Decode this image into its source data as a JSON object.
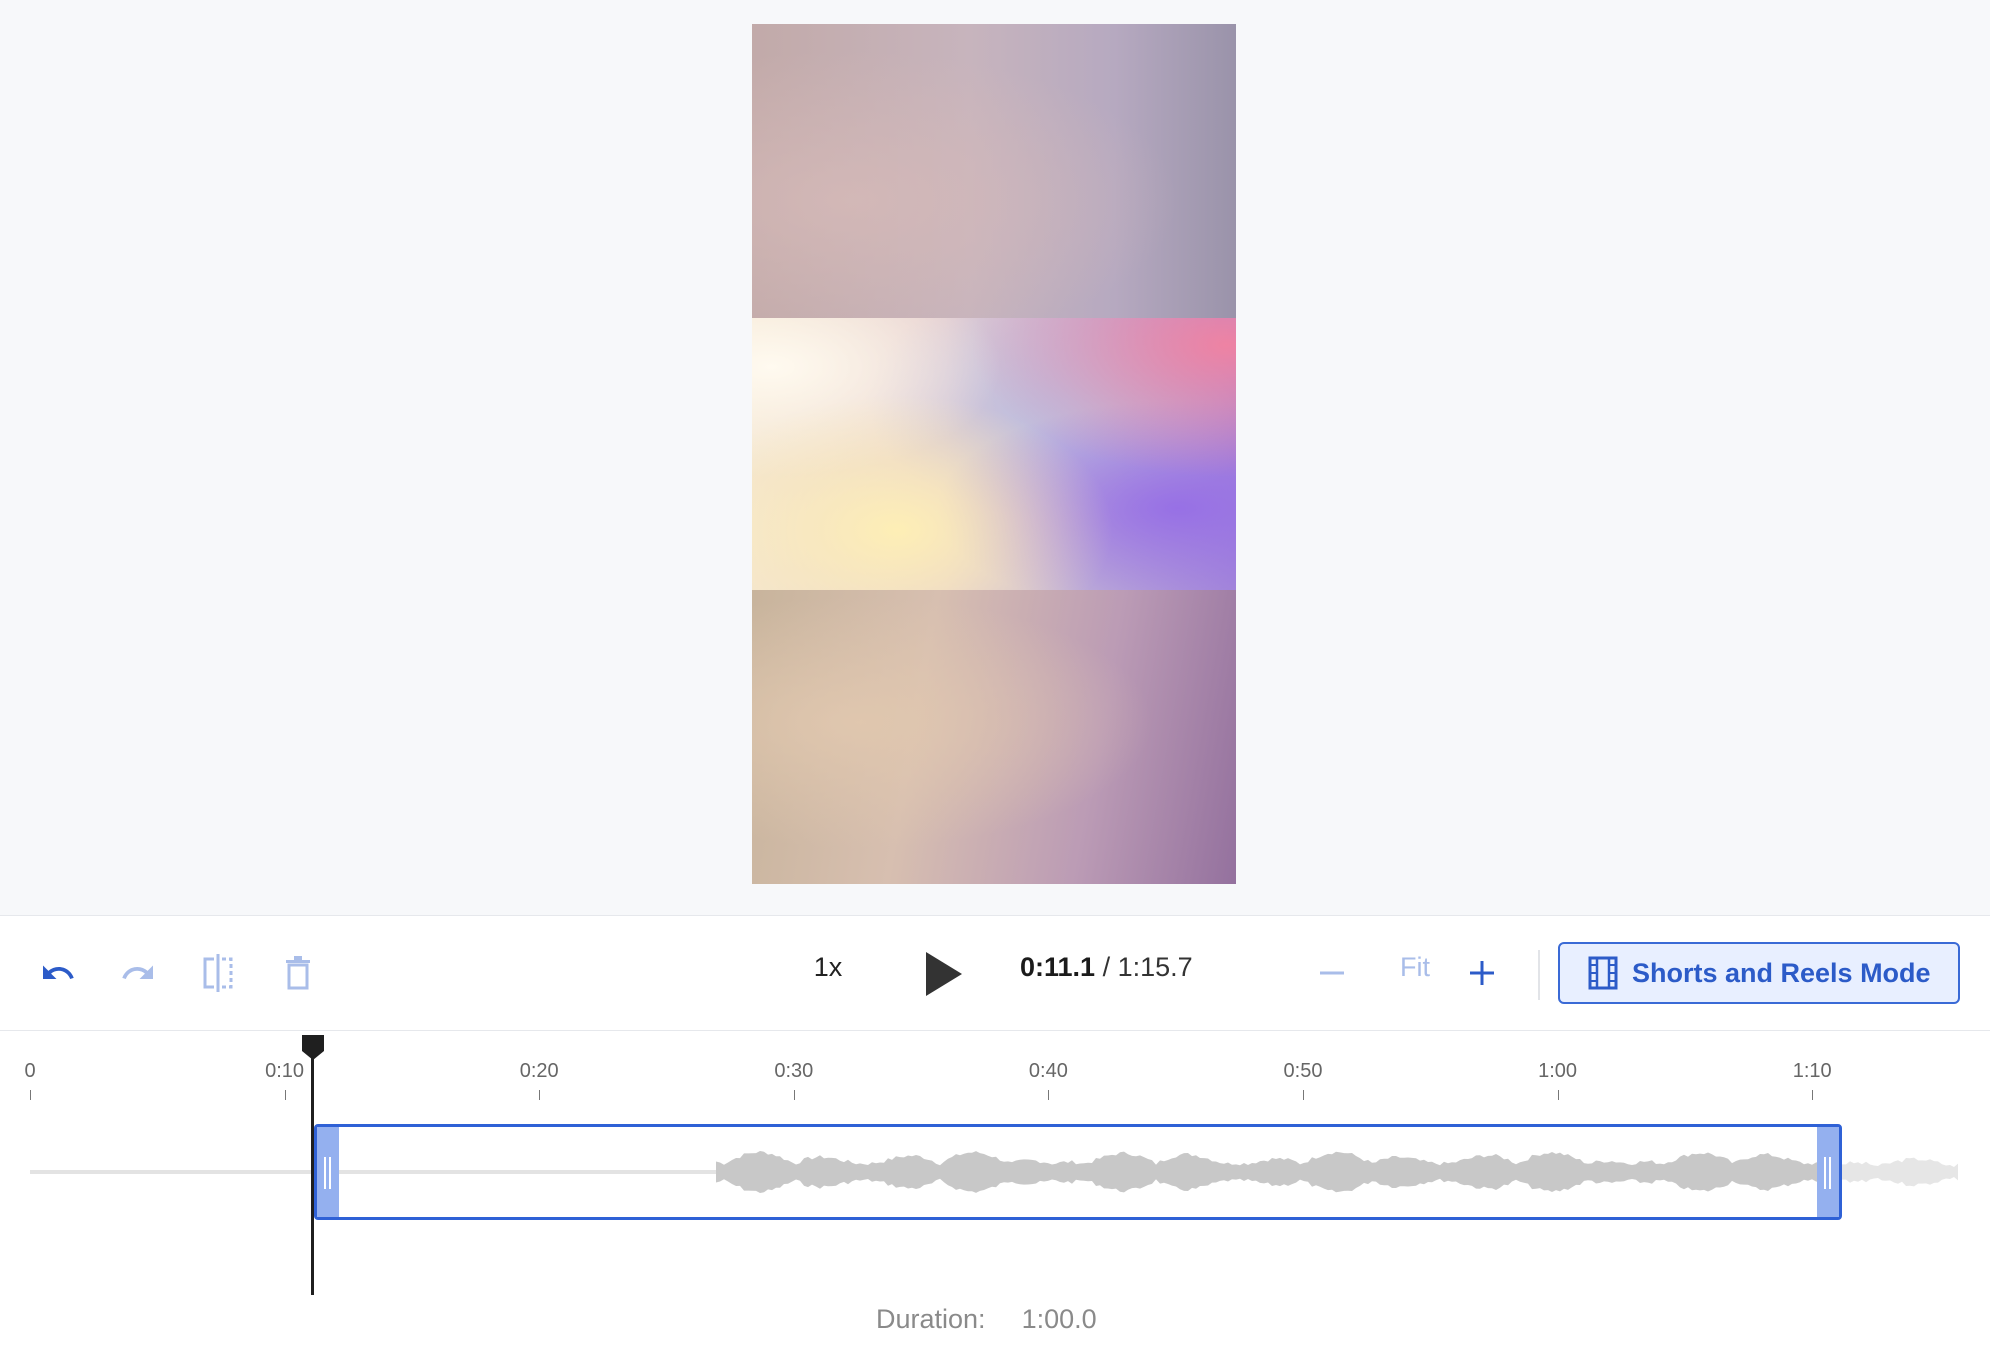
{
  "toolbar": {
    "speed": "1x",
    "current_time": "0:11.1",
    "separator": " / ",
    "total_time": "1:15.7",
    "zoom_fit_label": "Fit",
    "shorts_mode_label": "Shorts and Reels Mode"
  },
  "timeline": {
    "ticks": [
      "0",
      "0:10",
      "0:20",
      "0:30",
      "0:40",
      "0:50",
      "1:00",
      "1:10"
    ],
    "duration_label": "Duration:",
    "duration_value": "1:00.0"
  },
  "colors": {
    "accent": "#2f61d6",
    "accent_light": "#94b0ef",
    "waveform": "#c8c8c8",
    "disabled_icon": "#a9bde9"
  }
}
